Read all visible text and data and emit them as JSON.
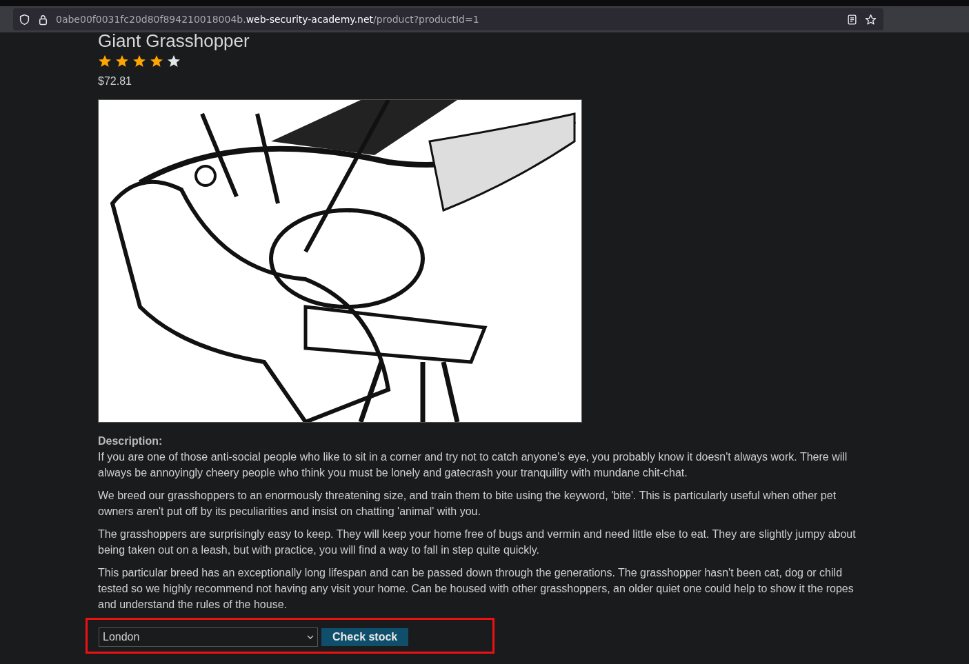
{
  "browser": {
    "url_host_prefix": "0abe00f0031fc20d80f894210018004b.",
    "url_domain": "web-security-academy.net",
    "url_path": "/product?productId=1"
  },
  "product": {
    "title": "Giant Grasshopper",
    "stars": 4,
    "price": "$72.81",
    "description_label": "Description:",
    "paragraphs": [
      "If you are one of those anti-social people who like to sit in a corner and try not to catch anyone's eye, you probably know it doesn't always work. There will always be annoyingly cheery people who think you must be lonely and gatecrash your tranquility with mundane chit-chat.",
      "We breed our grasshoppers to an enormously threatening size, and train them to bite using the keyword, 'bite'. This is particularly useful when other pet owners aren't put off by its peculiarities and insist on chatting 'animal' with you.",
      "The grasshoppers are surprisingly easy to keep. They will keep your home free of bugs and vermin and need little else to eat. They are slightly jumpy about being taken out on a leash, but with practice, you will find a way to fall in step quite quickly.",
      "This particular breed has an exceptionally long lifespan and can be passed down through the generations. The grasshopper hasn't been cat, dog or child tested so we highly recommend not having any visit your home. Can be housed with other grasshoppers, an older quiet one could help to show it the ropes and understand the rules of the house."
    ]
  },
  "stock_form": {
    "store": "London",
    "button": "Check stock",
    "highlighted": true
  }
}
